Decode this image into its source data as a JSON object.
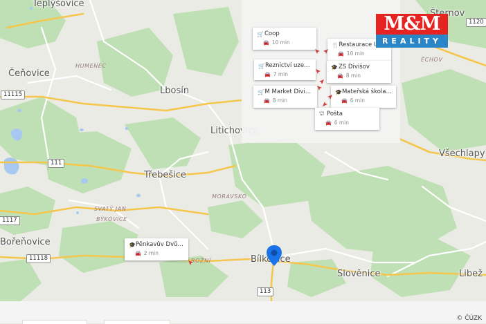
{
  "places": [
    {
      "id": "teplysovice",
      "label": "Teplýšovice"
    },
    {
      "id": "cenovice",
      "label": "Čeňovice"
    },
    {
      "id": "lbosin",
      "label": "Lbosín"
    },
    {
      "id": "litichovice",
      "label": "Litichovice"
    },
    {
      "id": "trebesice",
      "label": "Třebešice"
    },
    {
      "id": "borenovice",
      "label": "Bořeňovice"
    },
    {
      "id": "bilkovice",
      "label": "Bílkovice"
    },
    {
      "id": "slovenice",
      "label": "Slověnice"
    },
    {
      "id": "vsechlapy",
      "label": "Všechlapy"
    },
    {
      "id": "libez",
      "label": "Libež"
    },
    {
      "id": "sternov",
      "label": "Šternov"
    }
  ],
  "regions": [
    {
      "id": "humenec",
      "label": "HUMENEC"
    },
    {
      "id": "echov",
      "label": "ĚCHOV"
    },
    {
      "id": "moravsko",
      "label": "MORAVSKO"
    },
    {
      "id": "svaty-jan",
      "label": "SVATÝ JAN"
    },
    {
      "id": "bykovice",
      "label": "BÝKOVICE"
    },
    {
      "id": "rozeni",
      "label": "ROŽNÍ"
    }
  ],
  "roads": [
    {
      "id": "r11115",
      "label": "11115"
    },
    {
      "id": "r111",
      "label": "111"
    },
    {
      "id": "r1117",
      "label": "1117"
    },
    {
      "id": "r11118",
      "label": "11118"
    },
    {
      "id": "r113",
      "label": "113"
    },
    {
      "id": "r1120",
      "label": "1120"
    }
  ],
  "pois": [
    {
      "id": "coop",
      "icon": "cart-icon",
      "glyph": "🛒",
      "name": "Coop",
      "time": "10 min"
    },
    {
      "id": "restaurace",
      "icon": "restaurant-icon",
      "glyph": "🍴",
      "name": "Restaurace U S...",
      "time": "10 min"
    },
    {
      "id": "reznictvi",
      "icon": "cart-icon",
      "glyph": "🛒",
      "name": "Řeznictví uzenářs...",
      "time": "7 min"
    },
    {
      "id": "zs-divisov",
      "icon": "school-icon",
      "glyph": "🎓",
      "name": "ZŠ Divišov",
      "time": "8 min"
    },
    {
      "id": "m-market",
      "icon": "cart-icon",
      "glyph": "🛒",
      "name": "M Market Divišov",
      "time": "8 min"
    },
    {
      "id": "materska",
      "icon": "school-icon",
      "glyph": "🎓",
      "name": "Mateřská škola D...",
      "time": "6 min"
    },
    {
      "id": "posta",
      "icon": "post-office-icon",
      "glyph": "⛫",
      "name": "Pošta",
      "time": "6 min"
    },
    {
      "id": "penkavuv",
      "icon": "school-icon",
      "glyph": "🎓",
      "name": "Pěnkavův Dvůr Ta...",
      "time": "2 min"
    }
  ],
  "logo": {
    "top": "M&M",
    "bottom": "REALITY",
    "red": "#e52421",
    "blue": "#2a86c6"
  },
  "copyright": "© ČÚZK",
  "colors": {
    "forest": "#b8dcae",
    "water": "#a6c8ef",
    "road_major": "#f6c94e",
    "road_minor": "#ffffff",
    "pin": "#1a73e8"
  }
}
